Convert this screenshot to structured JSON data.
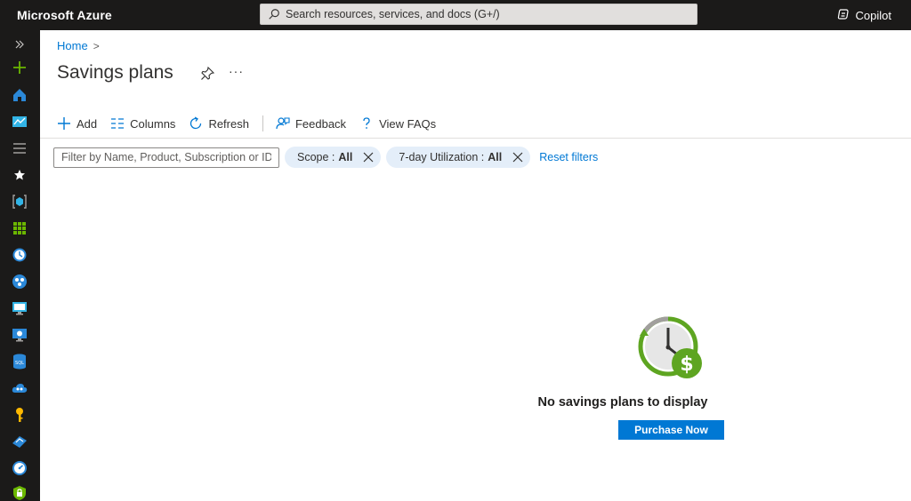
{
  "topbar": {
    "brand": "Microsoft Azure",
    "search_placeholder": "Search resources, services, and docs (G+/)",
    "copilot_label": "Copilot"
  },
  "rail": {
    "icons": [
      "expand-icon",
      "create-resource-icon",
      "home-icon",
      "dashboard-icon",
      "all-services-icon",
      "favorites-star-icon",
      "resource-groups-icon",
      "all-resources-icon",
      "recent-clock-icon",
      "app-services-icon",
      "virtual-machines-icon",
      "virtual-desktop-icon",
      "sql-database-icon",
      "cloud-services-icon",
      "key-vault-icon",
      "devops-icon",
      "monitor-gauge-icon",
      "security-lock-icon"
    ]
  },
  "breadcrumb": {
    "home": "Home",
    "separator": ">"
  },
  "page": {
    "title": "Savings plans",
    "more": "···"
  },
  "toolbar": {
    "add": "Add",
    "columns": "Columns",
    "refresh": "Refresh",
    "feedback": "Feedback",
    "faqs": "View FAQs"
  },
  "filters": {
    "placeholder": "Filter by Name, Product, Subscription or ID",
    "scope_label": "Scope : ",
    "scope_value": "All",
    "util_label": "7-day Utilization : ",
    "util_value": "All",
    "reset": "Reset filters"
  },
  "empty_state": {
    "message": "No savings plans to display",
    "button": "Purchase Now"
  },
  "colors": {
    "topbar_bg": "#1b1a19",
    "accent": "#0078d4",
    "pill_bg": "#e4eef9",
    "green": "#5ea521"
  }
}
